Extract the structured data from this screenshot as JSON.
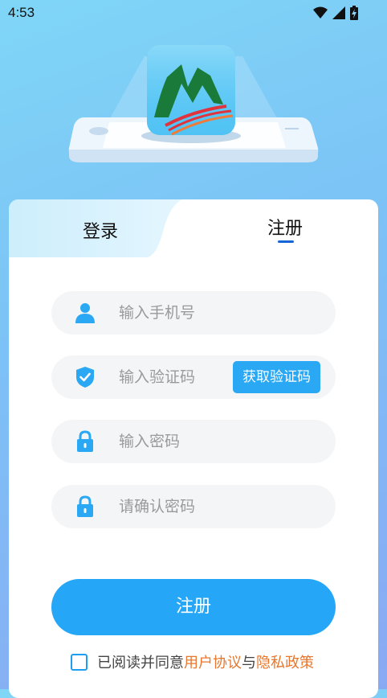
{
  "status_bar": {
    "time": "4:53",
    "icons": [
      "wifi-icon",
      "signal-icon",
      "battery-charging-icon"
    ]
  },
  "tabs": {
    "login": "登录",
    "register": "注册",
    "active": "register"
  },
  "form": {
    "phone": {
      "placeholder": "输入手机号",
      "icon": "user-icon"
    },
    "code": {
      "placeholder": "输入验证码",
      "icon": "shield-check-icon",
      "button": "获取验证码"
    },
    "password": {
      "placeholder": "输入密码",
      "icon": "lock-icon"
    },
    "confirm_password": {
      "placeholder": "请确认密码",
      "icon": "lock-icon"
    }
  },
  "submit": {
    "label": "注册"
  },
  "agreement": {
    "prefix": "已阅读并同意",
    "user_agreement": "用户协议",
    "connector": "与",
    "privacy_policy": "隐私政策",
    "checked": false
  },
  "colors": {
    "accent": "#25a6f6",
    "tab_underline": "#1565d8",
    "link": "#e8772d",
    "logo_green": "#1a7a3a",
    "logo_red": "#e0333c"
  }
}
